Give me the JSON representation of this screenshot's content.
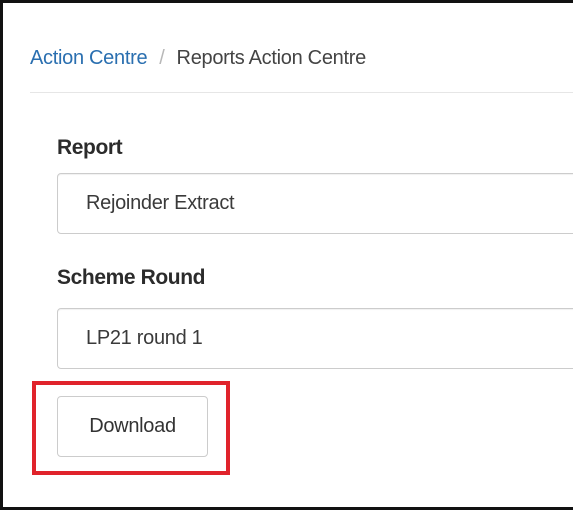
{
  "breadcrumb": {
    "parent": "Action Centre",
    "separator": "/",
    "current": "Reports Action Centre"
  },
  "form": {
    "report": {
      "label": "Report",
      "value": "Rejoinder Extract"
    },
    "scheme_round": {
      "label": "Scheme Round",
      "value": "LP21 round 1"
    },
    "download_label": "Download"
  },
  "colors": {
    "link": "#2a6fb0",
    "highlight": "#e0232b",
    "border": "#cccccc"
  }
}
